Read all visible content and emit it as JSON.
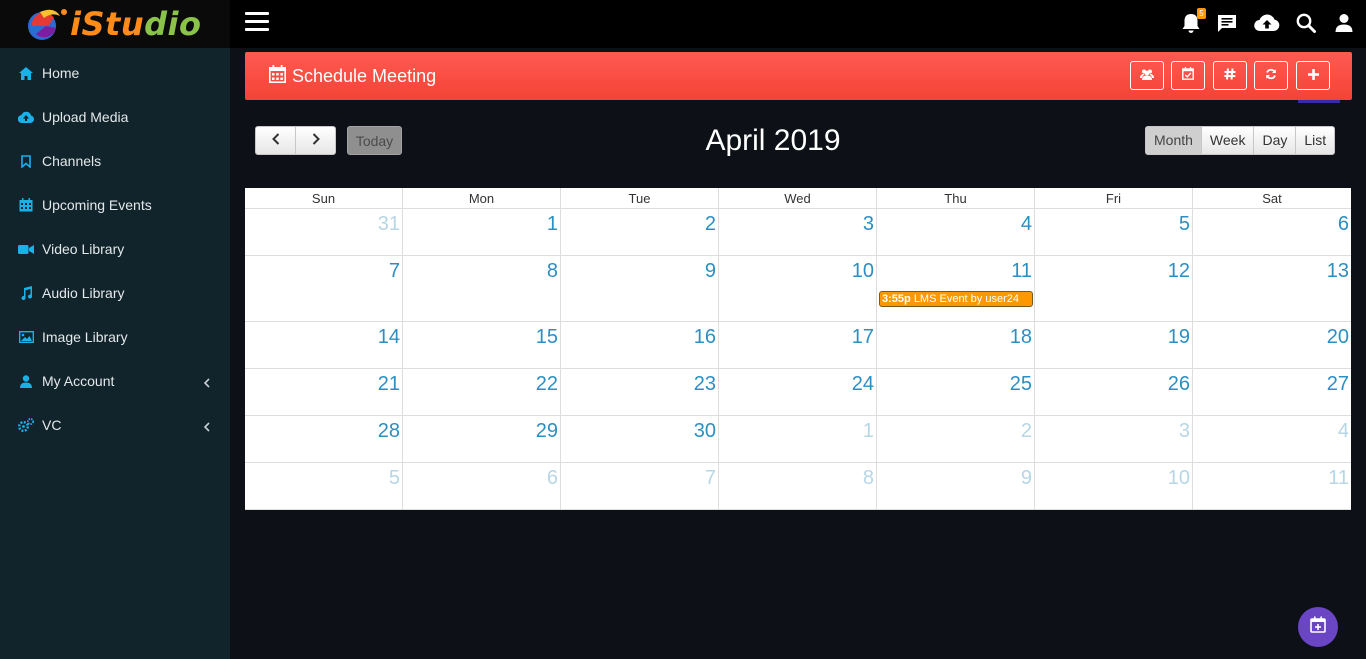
{
  "app": {
    "logo_text_a": "iStu",
    "logo_text_b": "dio"
  },
  "sidebar": {
    "items": [
      {
        "label": "Home",
        "icon": "home-icon"
      },
      {
        "label": "Upload Media",
        "icon": "cloud-upload-icon"
      },
      {
        "label": "Channels",
        "icon": "bookmark-icon"
      },
      {
        "label": "Upcoming Events",
        "icon": "calendar-icon"
      },
      {
        "label": "Video Library",
        "icon": "video-camera-icon"
      },
      {
        "label": "Audio Library",
        "icon": "music-note-icon"
      },
      {
        "label": "Image Library",
        "icon": "image-icon"
      },
      {
        "label": "My Account",
        "icon": "user-icon",
        "expandable": true
      },
      {
        "label": "VC",
        "icon": "cogs-icon",
        "expandable": true
      }
    ]
  },
  "topbar": {
    "notification_count": "5",
    "icons": [
      "bell-icon",
      "chat-icon",
      "cloud-upload-icon",
      "search-icon",
      "user-icon"
    ]
  },
  "header": {
    "title": "Schedule Meeting",
    "buttons": [
      "users-icon",
      "calendar-check-icon",
      "hashtag-icon",
      "refresh-icon",
      "plus-icon"
    ]
  },
  "toolbar": {
    "today_label": "Today",
    "month_title": "April 2019",
    "views": [
      "Month",
      "Week",
      "Day",
      "List"
    ],
    "active_view": "Month"
  },
  "calendar": {
    "weekday_headers": [
      "Sun",
      "Mon",
      "Tue",
      "Wed",
      "Thu",
      "Fri",
      "Sat"
    ],
    "weeks": [
      [
        {
          "d": "31",
          "other": true
        },
        {
          "d": "1"
        },
        {
          "d": "2"
        },
        {
          "d": "3"
        },
        {
          "d": "4"
        },
        {
          "d": "5"
        },
        {
          "d": "6"
        }
      ],
      [
        {
          "d": "7"
        },
        {
          "d": "8"
        },
        {
          "d": "9"
        },
        {
          "d": "10"
        },
        {
          "d": "11",
          "event": {
            "time": "3:55p",
            "title": "LMS Event by user24"
          }
        },
        {
          "d": "12"
        },
        {
          "d": "13"
        }
      ],
      [
        {
          "d": "14"
        },
        {
          "d": "15"
        },
        {
          "d": "16"
        },
        {
          "d": "17"
        },
        {
          "d": "18"
        },
        {
          "d": "19"
        },
        {
          "d": "20"
        }
      ],
      [
        {
          "d": "21"
        },
        {
          "d": "22"
        },
        {
          "d": "23"
        },
        {
          "d": "24"
        },
        {
          "d": "25"
        },
        {
          "d": "26"
        },
        {
          "d": "27"
        }
      ],
      [
        {
          "d": "28"
        },
        {
          "d": "29"
        },
        {
          "d": "30"
        },
        {
          "d": "1",
          "other": true
        },
        {
          "d": "2",
          "other": true
        },
        {
          "d": "3",
          "other": true
        },
        {
          "d": "4",
          "other": true
        }
      ],
      [
        {
          "d": "5",
          "other": true
        },
        {
          "d": "6",
          "other": true
        },
        {
          "d": "7",
          "other": true
        },
        {
          "d": "8",
          "other": true
        },
        {
          "d": "9",
          "other": true
        },
        {
          "d": "10",
          "other": true
        },
        {
          "d": "11",
          "other": true
        }
      ]
    ]
  },
  "colors": {
    "accent_red": "#f44336",
    "event_orange": "#ff9800",
    "day_blue": "#2c8fc2",
    "fab_purple": "#6a45c4"
  }
}
